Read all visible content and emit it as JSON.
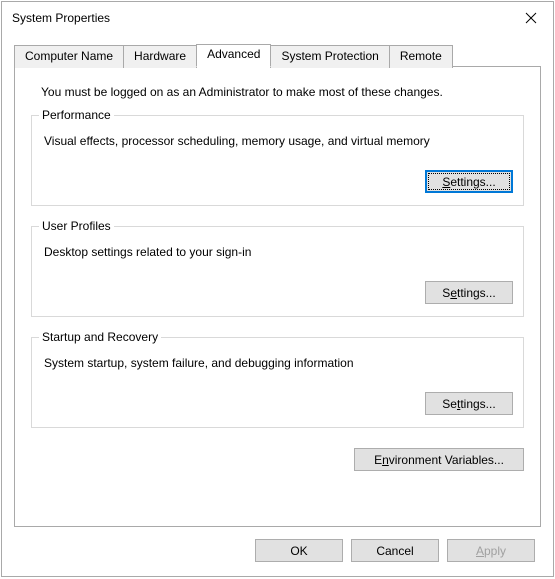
{
  "window": {
    "title": "System Properties"
  },
  "tabs": {
    "computer_name": "Computer Name",
    "hardware": "Hardware",
    "advanced": "Advanced",
    "system_protection": "System Protection",
    "remote": "Remote"
  },
  "panel": {
    "admin_message": "You must be logged on as an Administrator to make most of these changes.",
    "performance": {
      "legend": "Performance",
      "desc": "Visual effects, processor scheduling, memory usage, and virtual memory",
      "settings": "Settings..."
    },
    "userprofiles": {
      "legend": "User Profiles",
      "desc": "Desktop settings related to your sign-in",
      "settings": "Settings..."
    },
    "startup": {
      "legend": "Startup and Recovery",
      "desc": "System startup, system failure, and debugging information",
      "settings": "Settings..."
    },
    "env_button": "Environment Variables..."
  },
  "buttons": {
    "ok": "OK",
    "cancel": "Cancel",
    "apply": "Apply"
  }
}
